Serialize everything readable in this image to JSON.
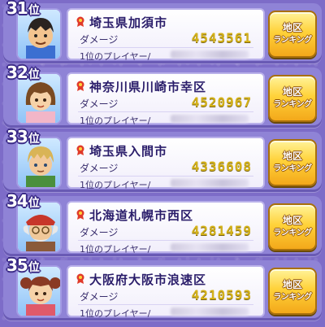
{
  "ranking": {
    "button_line1": "地区",
    "button_line2": "ランキング",
    "damage_label": "ダメージ",
    "player_label": "1位のプレイヤー/",
    "rank_suffix": "位",
    "rows": [
      {
        "rank": "31",
        "region": "埼玉県加須市",
        "damage": "4543561",
        "avatar": "boy-dark-hair-icon"
      },
      {
        "rank": "32",
        "region": "神奈川県川崎市幸区",
        "damage": "4520967",
        "avatar": "girl-brown-hair-icon"
      },
      {
        "rank": "33",
        "region": "埼玉県入間市",
        "damage": "4336608",
        "avatar": "boy-blonde-hair-icon"
      },
      {
        "rank": "34",
        "region": "北海道札幌市西区",
        "damage": "4281459",
        "avatar": "old-man-red-hat-icon"
      },
      {
        "rank": "35",
        "region": "大阪府大阪市浪速区",
        "damage": "4210593",
        "avatar": "girl-pigtails-icon"
      }
    ]
  },
  "colors": {
    "background": "#7d6cc8",
    "damage_value": "#d4b21a",
    "button": "#ffd23a",
    "region_text": "#2a1d6a"
  }
}
